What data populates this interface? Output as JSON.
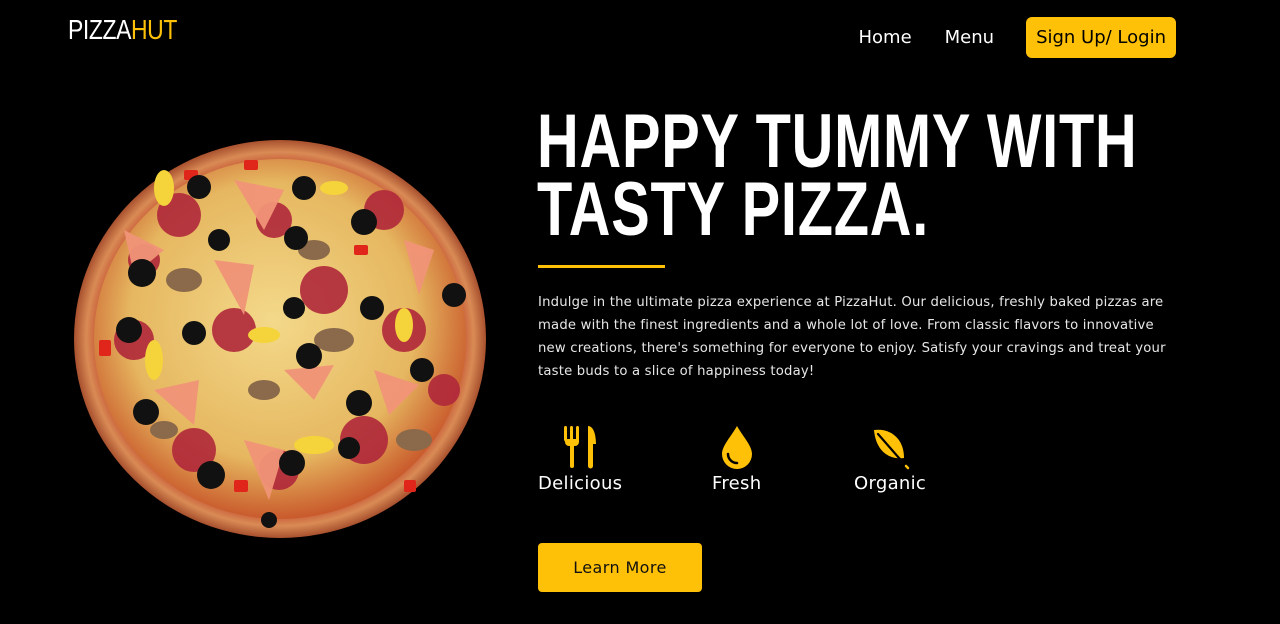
{
  "brand": {
    "logo_part1": "PIZZA",
    "logo_part2": "HUT",
    "accent_color": "#ffc107"
  },
  "nav": {
    "home": "Home",
    "menu": "Menu",
    "login": "Sign Up/ Login"
  },
  "hero": {
    "headline_line1": "HAPPY TUMMY WITH",
    "headline_line2": "TASTY PIZZA.",
    "description": "Indulge in the ultimate pizza experience at PizzaHut. Our delicious, freshly baked pizzas are made with the finest ingredients and a whole lot of love. From classic flavors to innovative new creations, there's something for everyone to enjoy. Satisfy your cravings and treat your taste buds to a slice of happiness today!",
    "features": [
      {
        "label": "Delicious",
        "icon": "utensils-icon"
      },
      {
        "label": "Fresh",
        "icon": "droplet-icon"
      },
      {
        "label": "Organic",
        "icon": "leaf-icon"
      }
    ],
    "cta_label": "Learn More"
  }
}
